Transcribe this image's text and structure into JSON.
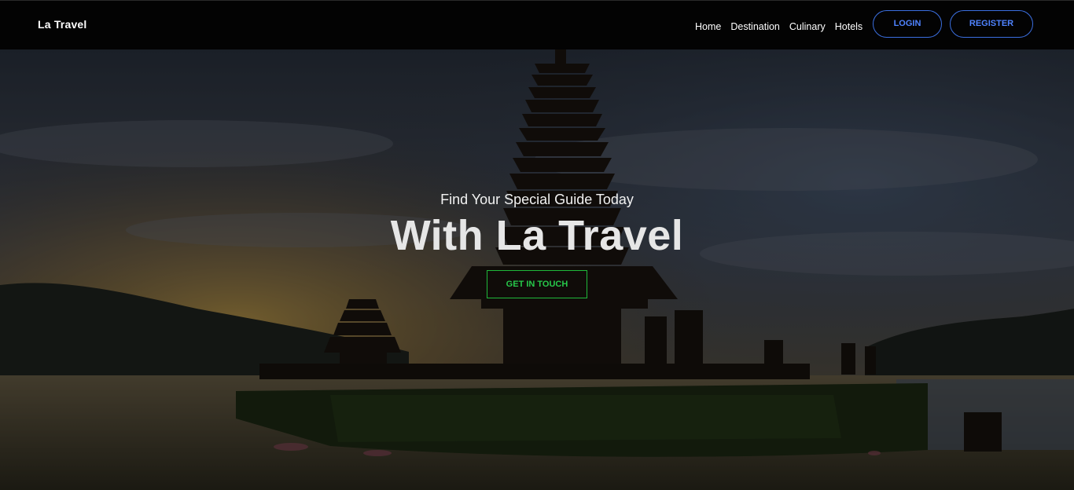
{
  "header": {
    "brand": "La Travel",
    "nav": [
      {
        "label": "Home"
      },
      {
        "label": "Destination"
      },
      {
        "label": "Culinary"
      },
      {
        "label": "Hotels"
      }
    ],
    "login_label": "LOGIN",
    "register_label": "REGISTER"
  },
  "hero": {
    "subtitle": "Find Your Special Guide Today",
    "title": "With La Travel",
    "cta_label": "GET IN TOUCH"
  },
  "colors": {
    "navbar_bg": "#030303",
    "auth_button": "#4f83ff",
    "cta": "#27c84a"
  }
}
